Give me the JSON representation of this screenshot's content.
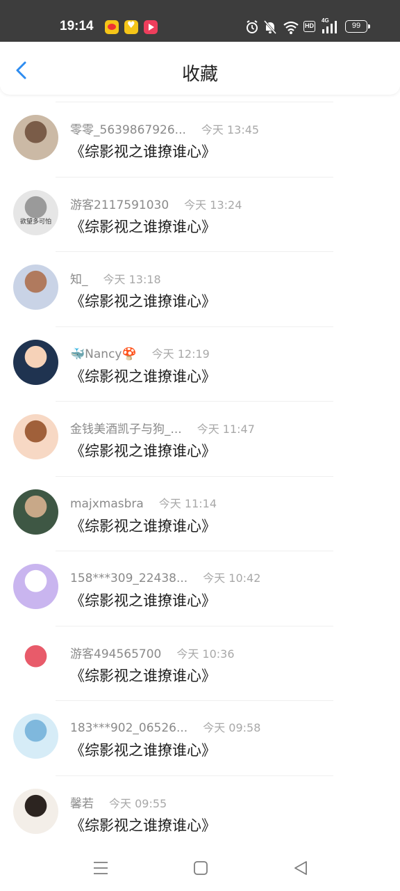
{
  "status_bar": {
    "time": "19:14",
    "notification_icons": [
      "weibo-icon",
      "heart-app-icon",
      "video-app-icon"
    ],
    "system_icons": [
      "alarm-icon",
      "mute-icon",
      "wifi-icon",
      "hd-icon",
      "signal-icon",
      "battery-icon"
    ],
    "hd_label": "HD",
    "network_label": "4G",
    "battery_level": "99"
  },
  "header": {
    "title": "收藏",
    "back_icon": "chevron-left-icon",
    "accent_color": "#2d8cf0"
  },
  "list": {
    "items": [
      {
        "user": "零零_5639867926...",
        "time": "今天 13:45",
        "content": "《综影视之谁撩谁心》",
        "avatar_colors": [
          "#cbb9a5",
          "#7a5c48"
        ]
      },
      {
        "user": "游客2117591030",
        "time": "今天 13:24",
        "content": "《综影视之谁撩谁心》",
        "avatar_colors": [
          "#e6e6e6",
          "#9a9a9a"
        ],
        "avatar_text": "欲望多可怕"
      },
      {
        "user": "知_",
        "time": "今天 13:18",
        "content": "《综影视之谁撩谁心》",
        "avatar_colors": [
          "#c9d3e6",
          "#b07a5e"
        ]
      },
      {
        "user": "🐳Nancy🍄",
        "time": "今天 12:19",
        "content": "《综影视之谁撩谁心》",
        "avatar_colors": [
          "#1f3350",
          "#f6d2b8"
        ]
      },
      {
        "user": "金钱美酒凯子与狗_...",
        "time": "今天 11:47",
        "content": "《综影视之谁撩谁心》",
        "avatar_colors": [
          "#f7d8c4",
          "#a0603a"
        ]
      },
      {
        "user": "majxmasbra",
        "time": "今天 11:14",
        "content": "《综影视之谁撩谁心》",
        "avatar_colors": [
          "#3e5744",
          "#c8a888"
        ]
      },
      {
        "user": "158***309_22438...",
        "time": "今天 10:42",
        "content": "《综影视之谁撩谁心》",
        "avatar_colors": [
          "#c9b5ef",
          "#ffffff"
        ]
      },
      {
        "user": "游客494565700",
        "time": "今天 10:36",
        "content": "《综影视之谁撩谁心》",
        "avatar_colors": [
          "#ffffff",
          "#e85b6a"
        ]
      },
      {
        "user": "183***902_06526...",
        "time": "今天 09:58",
        "content": "《综影视之谁撩谁心》",
        "avatar_colors": [
          "#d6ecf7",
          "#7fb8dd"
        ]
      },
      {
        "user": "馨若",
        "time": "今天 09:55",
        "content": "《综影视之谁撩谁心》",
        "avatar_colors": [
          "#f3eee8",
          "#2c2420"
        ]
      }
    ]
  },
  "nav_bar": {
    "icons": [
      "menu-icon",
      "home-square-icon",
      "back-triangle-icon"
    ]
  }
}
